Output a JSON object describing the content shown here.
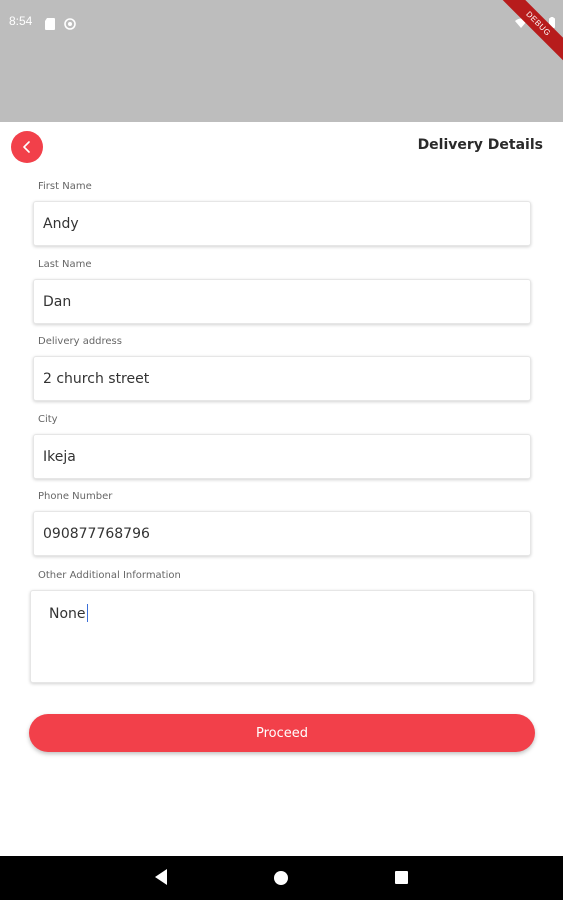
{
  "status_bar": {
    "time": "8:54",
    "debug_label": "DEBUG",
    "icons": [
      "sd-card-icon",
      "sync-icon",
      "wifi-icon",
      "signal-icon",
      "battery-icon"
    ]
  },
  "header": {
    "title": "Delivery Details",
    "back_icon": "chevron-left-icon"
  },
  "form": {
    "first_name": {
      "label": "First Name",
      "value": "Andy"
    },
    "last_name": {
      "label": "Last Name",
      "value": "Dan"
    },
    "address": {
      "label": "Delivery address",
      "value": "2 church street"
    },
    "city": {
      "label": "City",
      "value": "Ikeja"
    },
    "phone": {
      "label": "Phone Number",
      "value": "090877768796"
    },
    "additional": {
      "label": "Other Additional Information",
      "value": "None"
    }
  },
  "actions": {
    "proceed_label": "Proceed"
  },
  "colors": {
    "accent": "#f2404a",
    "status_bar": "#bdbdbd",
    "nav_bar": "#000000"
  }
}
